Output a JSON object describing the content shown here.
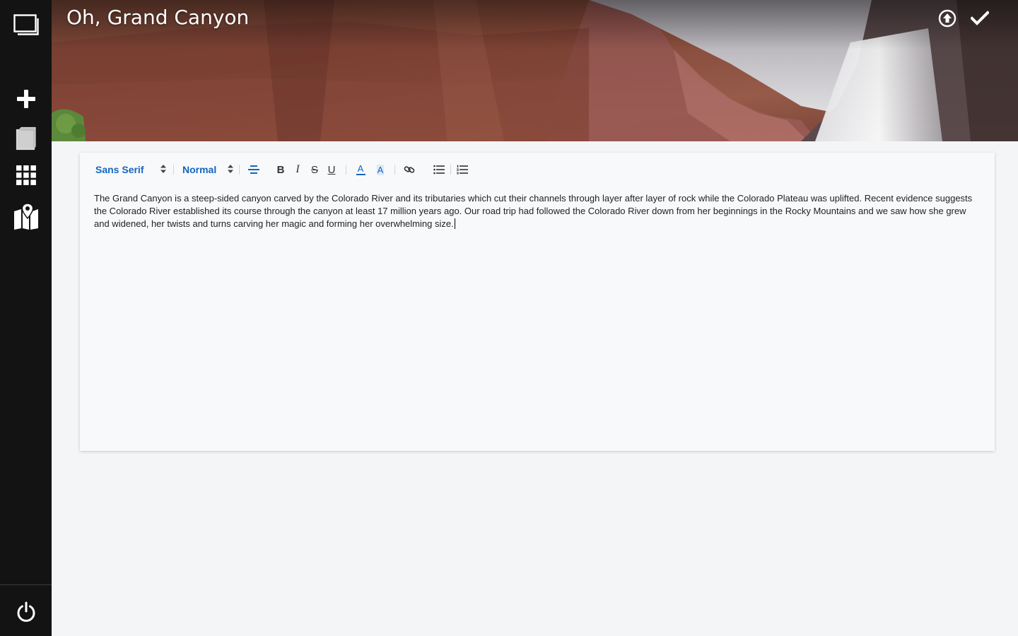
{
  "sidebar": {
    "items": [
      {
        "icon": "pages-icon"
      },
      {
        "icon": "plus-icon"
      },
      {
        "icon": "notebook-icon"
      },
      {
        "icon": "grid-icon"
      },
      {
        "icon": "map-icon"
      }
    ],
    "footer_icon": "power-icon"
  },
  "header": {
    "title": "Oh, Grand Canyon",
    "actions": [
      {
        "icon": "upload-circle-icon"
      },
      {
        "icon": "checkmark-icon"
      }
    ]
  },
  "toolbar": {
    "font": "Sans Serif",
    "size": "Normal",
    "bold_label": "B",
    "italic_label": "I",
    "strike_label": "S",
    "underline_label": "U",
    "text_color_label": "A",
    "background_color_label": "A",
    "accent_color": "#1565c0"
  },
  "editor": {
    "text": "The Grand Canyon is a steep-sided canyon carved by the Colorado River and its tributaries which cut their channels through layer after layer of rock while the Colorado Plateau was uplifted. Recent evidence suggests the Colorado River established its course through the canyon at least 17 million years ago. Our road trip had followed the Colorado River down from her beginnings in the Rocky Mountains and we saw how she grew and widened, her twists and turns carving her magic and forming her overwhelming size."
  }
}
